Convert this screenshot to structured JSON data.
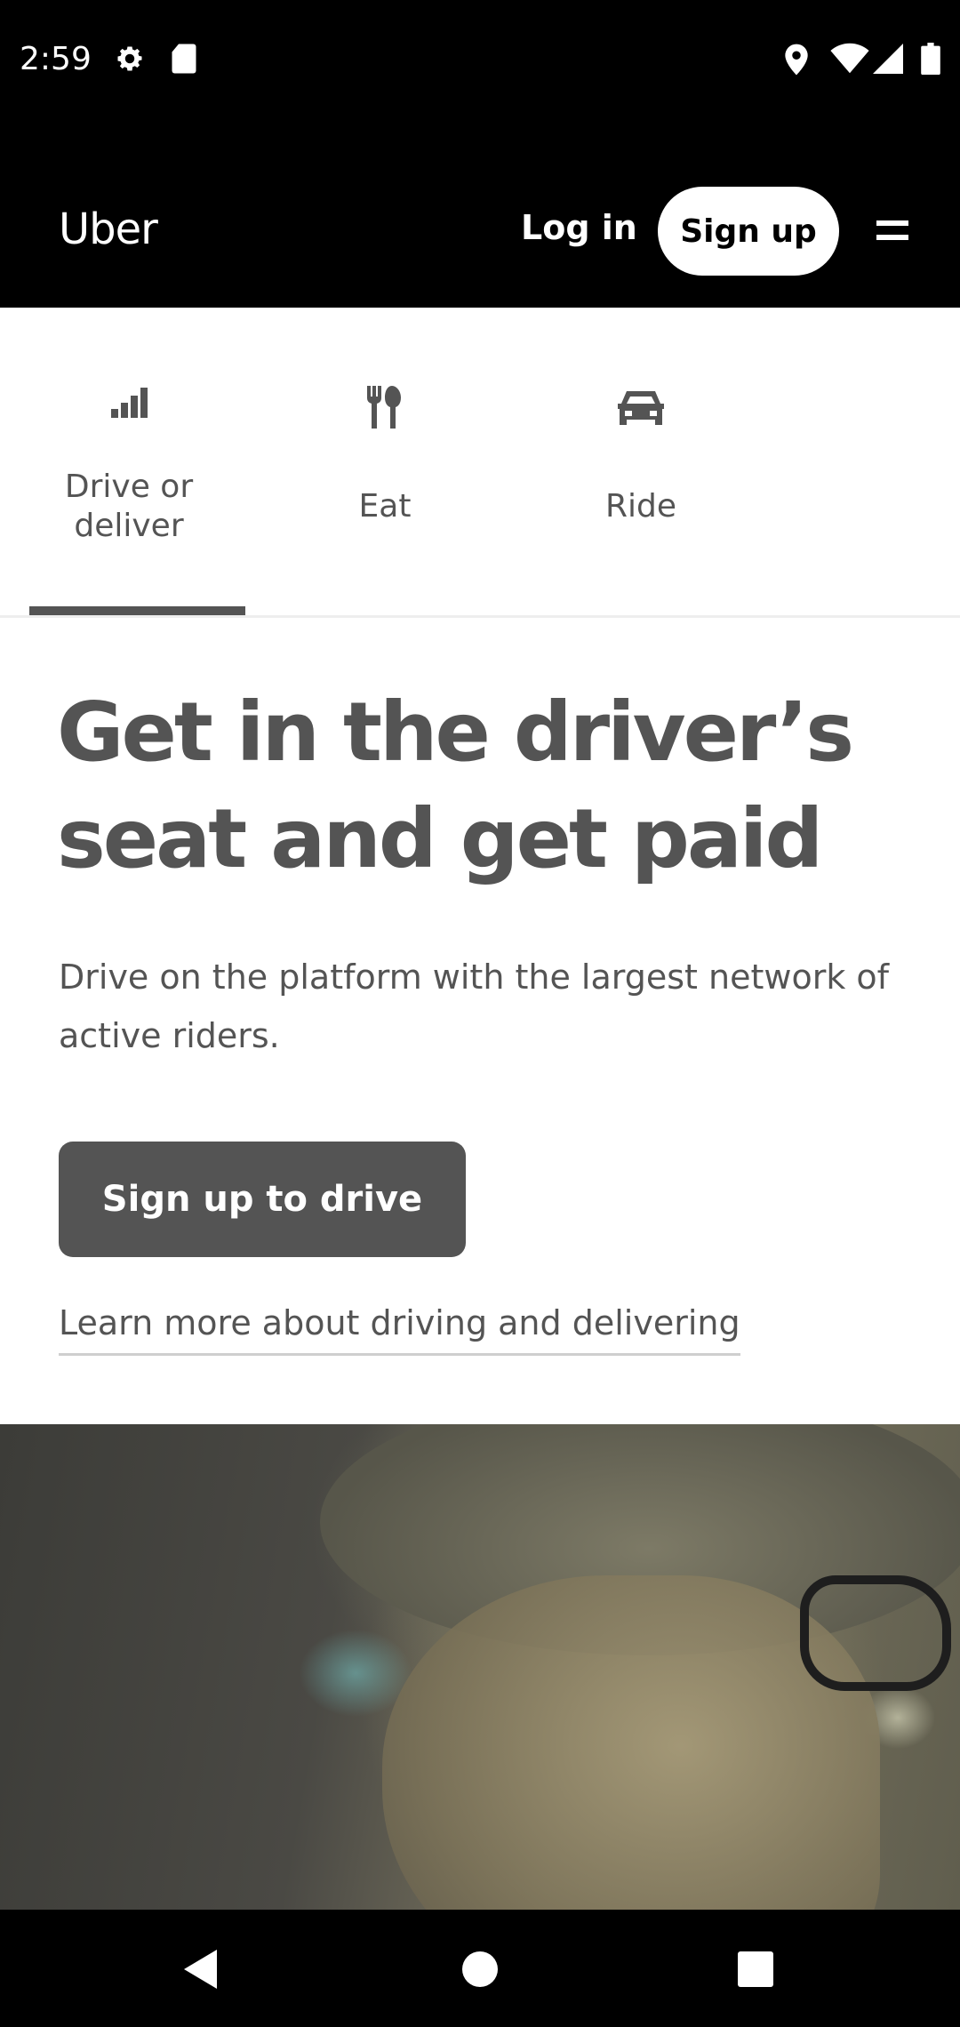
{
  "status_bar": {
    "time": "2:59",
    "icons": [
      "gear-icon",
      "sd-card-icon",
      "location-icon",
      "wifi-icon",
      "signal-icon",
      "battery-icon"
    ]
  },
  "header": {
    "logo": "Uber",
    "login_label": "Log in",
    "signup_label": "Sign up",
    "menu_icon": "hamburger-menu-icon"
  },
  "tabs": [
    {
      "label": "Drive or deliver",
      "icon": "bar-chart-icon",
      "selected": true
    },
    {
      "label": "Eat",
      "icon": "fork-knife-icon",
      "selected": false
    },
    {
      "label": "Ride",
      "icon": "car-icon",
      "selected": false
    }
  ],
  "main": {
    "headline": "Get in the driver’s seat and get paid",
    "subtext": "Drive on the platform with the largest network of active riders.",
    "cta_label": "Sign up to drive",
    "learn_more": "Learn more about driving and delivering"
  },
  "nav_bar": {
    "buttons": [
      "back-icon",
      "home-icon",
      "recents-icon"
    ]
  },
  "colors": {
    "header_bg": "#000000",
    "text_gray": "#545454",
    "button_gray": "#545454"
  }
}
